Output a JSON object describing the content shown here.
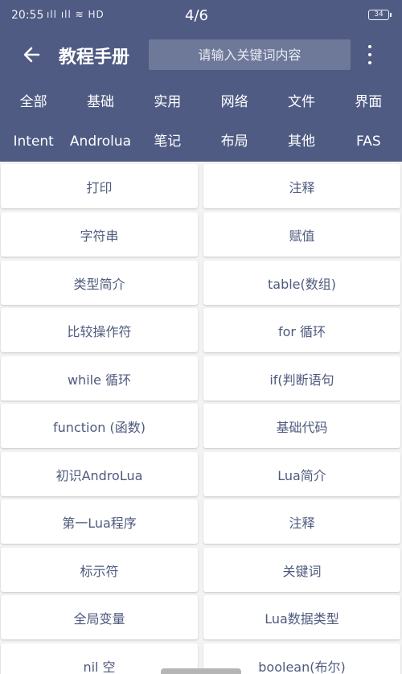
{
  "status_bar": {
    "time": "20:55",
    "signal": "ıll ıll ≋ HD",
    "page_indicator": "4/6",
    "battery": "34"
  },
  "header": {
    "title": "教程手册",
    "search_placeholder": "请输入关键词内容"
  },
  "categories_row1": [
    "全部",
    "基础",
    "实用",
    "网络",
    "文件",
    "界面"
  ],
  "categories_row2": [
    "Intent",
    "Androlua",
    "笔记",
    "布局",
    "其他",
    "FAS"
  ],
  "items": [
    [
      "打印",
      "注释"
    ],
    [
      "字符串",
      "赋值"
    ],
    [
      "类型简介",
      "table(数组)"
    ],
    [
      "比较操作符",
      "for 循环"
    ],
    [
      "while 循环",
      "if(判断语句"
    ],
    [
      "function (函数)",
      "基础代码"
    ],
    [
      "初识AndroLua",
      "Lua简介"
    ],
    [
      "第一Lua程序",
      "注释"
    ],
    [
      "标示符",
      "关键词"
    ],
    [
      "全局变量",
      "Lua数据类型"
    ],
    [
      "nil 空",
      "boolean(布尔)"
    ]
  ],
  "colors": {
    "header": "#4f5b83",
    "card_text": "#4e5a7d",
    "background": "#f3f3f3"
  }
}
